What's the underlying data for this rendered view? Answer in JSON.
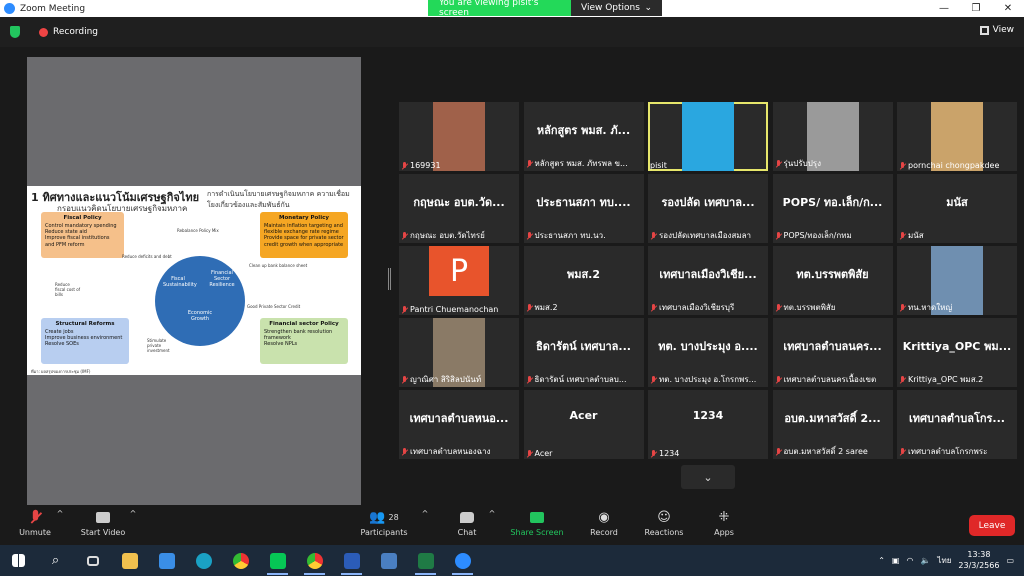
{
  "window": {
    "title": "Zoom Meeting",
    "viewing_text": "You are viewing pisit's screen",
    "view_options": "View Options"
  },
  "topbar": {
    "recording": "Recording",
    "view": "View"
  },
  "slide": {
    "title": "ทิศทางและแนวโน้มเศรษฐกิจไทย",
    "subtitle": "กรอบแนวคิดนโยบายเศรษฐกิจมหภาค",
    "right_title": "การดำเนินนโยบายเศรษฐกิจมหภาค ความเชื่อมโยงเกี่ยวข้องและสัมพันธ์กัน",
    "fiscal": {
      "head": "Fiscal Policy",
      "items": [
        "Control mandatory spending",
        "Reduce state aid",
        "Improve fiscal institutions and PFM reform"
      ]
    },
    "monetary": {
      "head": "Monetary Policy",
      "items": [
        "Maintain inflation targeting and flexible exchange rate regime",
        "Provide space for private sector credit growth when appropriate"
      ]
    },
    "structural": {
      "head": "Structural Reforms",
      "items": [
        "Create jobs",
        "Improve business environment",
        "Resolve SOEs"
      ]
    },
    "financial": {
      "head": "Financial sector Policy",
      "items": [
        "Strengthen bank resolution framework",
        "Resolve NPLs"
      ]
    },
    "circle": {
      "fiscal": "Fiscal Sustainability",
      "financial": "Financial Sector Resilience",
      "growth": "Economic Growth"
    },
    "labels": {
      "rebalance": "Rebalance Policy Mix",
      "reduce": "Reduce deficits and debt",
      "cleanup": "Clean up bank balance sheet",
      "reduce_fiscal": "Reduce fiscal cost of bills",
      "stimulate": "Stimulate private investment",
      "good_credit": "Good Private Sector Credit"
    },
    "footer": "ที่มา: ผลสรุปของการประชุม (IMF)"
  },
  "participants": [
    {
      "big": "",
      "name": "169931",
      "thumb": "#a0614a"
    },
    {
      "big": "หลักสูตร พมส. ภั...",
      "name": "หลักสูตร พมส. ภัทรพล ข..."
    },
    {
      "big": "",
      "name": "pisit",
      "thumb": "#2aa7e0",
      "active": true
    },
    {
      "big": "",
      "name": "รุ่นปรับปรุง",
      "thumb": "#9a9a9a"
    },
    {
      "big": "",
      "name": "pornchai chongpakdee",
      "thumb": "#caa36a"
    },
    {
      "big": "กฤษณะ  อบต.วัด...",
      "name": "กฤษณะ  อบต.วัดไทรย์"
    },
    {
      "big": "ประธานสภา ทบ....",
      "name": "ประธานสภา ทบ.นว."
    },
    {
      "big": "รองปลัด เทศบาล...",
      "name": "รองปลัดเทศบาลเมืองสมลา"
    },
    {
      "big": "POPS/ ทอ.เล็ก/ก...",
      "name": "POPS/ทองเล็ก/กทม"
    },
    {
      "big": "มนัส",
      "name": "มนัส"
    },
    {
      "big": "",
      "name": "Pantri Chuemanochan",
      "thumb": "#e8542c",
      "letter": "P"
    },
    {
      "big": "พมส.2",
      "name": "พมส.2"
    },
    {
      "big": "เทศบาลเมืองวิเชีย...",
      "name": "เทศบาลเมืองวิเชียรบุรี"
    },
    {
      "big": "ทต.บรรพตพิสัย",
      "name": "ทต.บรรพตพิสัย"
    },
    {
      "big": "",
      "name": "ทน.หาดใหญ่",
      "thumb": "#6f8fb0"
    },
    {
      "big": "",
      "name": "ญาณิศา สิริสิลปนันท์",
      "thumb": "#8a7a66"
    },
    {
      "big": "ธิดารัตน์  เทศบาล...",
      "name": "ธิดารัตน์  เทศบาลตำบลบ..."
    },
    {
      "big": "ทต. บางประมุง อ....",
      "name": "ทต. บางประมุง อ.โกรกพร..."
    },
    {
      "big": "เทศบาลตำบลนคร...",
      "name": "เทศบาลตำบลนครเนื้องเขต"
    },
    {
      "big": "Krittiya_OPC พม...",
      "name": "Krittiya_OPC พมส.2"
    },
    {
      "big": "เทศบาลตำบลหนอ...",
      "name": "เทศบาลตำบลหนองฉาง"
    },
    {
      "big": "Acer",
      "name": "Acer"
    },
    {
      "big": "1234",
      "name": "1234"
    },
    {
      "big": "อบต.มหาสวัสดิ์ 2...",
      "name": "อบต.มหาสวัสดิ์ 2 saree"
    },
    {
      "big": "เทศบาลตำบลโกร...",
      "name": "เทศบาลตำบลโกรกพระ"
    }
  ],
  "toolbar": {
    "unmute": "Unmute",
    "start_video": "Start Video",
    "participants": "Participants",
    "participants_count": "28",
    "chat": "Chat",
    "share": "Share Screen",
    "record": "Record",
    "reactions": "Reactions",
    "apps": "Apps",
    "leave": "Leave"
  },
  "taskbar": {
    "lang": "ไทย",
    "time": "13:38",
    "date": "23/3/2566"
  },
  "colors": {
    "share_green": "#23d959",
    "leave_red": "#e02828",
    "active_border": "#e6e66b"
  }
}
